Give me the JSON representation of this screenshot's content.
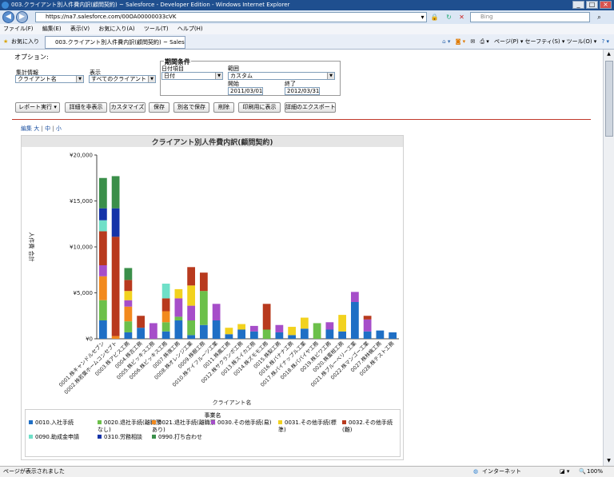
{
  "browser": {
    "title": "003.クライアント別人件費内訳(顧問契約) ~ Salesforce - Developer Edition - Windows Internet Explorer",
    "url": "https://na7.salesforce.com/00OA00000033cVK",
    "search_placeholder": "Bing",
    "menu": [
      "ファイル(F)",
      "編集(E)",
      "表示(V)",
      "お気に入り(A)",
      "ツール(T)",
      "ヘルプ(H)"
    ],
    "favorites_label": "お気に入り",
    "tab_title": "003.クライアント別人件費内訳(顧問契約) ~ Salesforc...",
    "toolbar_right": "ページ(P) ▾  セーフティ(S) ▾  ツール(O) ▾",
    "status_left": "ページが表示されました",
    "status_zone": "インターネット",
    "zoom": "100%"
  },
  "options": {
    "heading": "オプション:",
    "summarize_label": "集計情報",
    "summarize_value": "クライアント名",
    "show_label": "表示",
    "show_value": "すべてのクライアント",
    "period": {
      "heading": "期間条件",
      "date_field_label": "日付項目",
      "date_field_value": "日付",
      "range_label": "範囲",
      "range_value": "カスタム",
      "start_label": "開始",
      "start_value": "2011/03/01",
      "end_label": "終了",
      "end_value": "2012/03/31"
    }
  },
  "buttons": {
    "run": "レポート実行 ▾",
    "hide_details": "詳細を非表示",
    "customize": "カスタマイズ",
    "save": "保存",
    "save_as": "別名で保存",
    "delete": "削除",
    "printable": "印刷用に表示",
    "export": "詳細のエクスポート"
  },
  "chart_size": {
    "edit": "編集",
    "large": "大",
    "medium": "中",
    "small": "小",
    "sep": "|"
  },
  "chart_data": {
    "type": "bar",
    "stacked": true,
    "title": "クライアント別人件費内訳(顧問契約)",
    "xlabel": "クライアント名",
    "ylabel": "人件費 合計",
    "ylim": [
      0,
      20000
    ],
    "yticks": [
      "¥0",
      "¥5,000",
      "¥10,000",
      "¥15,000",
      "¥20,000"
    ],
    "grid": false,
    "legend_title": "事業名",
    "legend_position": "bottom",
    "categories": [
      "0001.株キャンドルセブン",
      "0002.株若葉ホームコンセプト",
      "0003.株アビス工務",
      "0004.株吉工務",
      "0005.株ビッキス工務",
      "0006.株ビッキス工務",
      "0007.株嶺工務",
      "0008.株オレンジ工業",
      "0009.株樹工務",
      "0010.株ケイフルーツ工業",
      "0011.株嵐工務",
      "0012.株サクランボ工務",
      "0013.株スイカ工務",
      "0014.株ズモモ工務",
      "0015.株梨工務",
      "0016.株バナナ工務",
      "0017.株パイナップル工業",
      "0018.株パパイヤ工務",
      "0019.株ビワ工務",
      "0020.株蜜柑工務",
      "0021.株ブルーベリー工業",
      "0022.株マンゴー工業",
      "0027.株林檎工務",
      "0028.株テスト工務"
    ],
    "series": [
      {
        "name": "0010.入社手続",
        "color": "#1f6fc5",
        "values": [
          2000,
          0,
          700,
          1200,
          0,
          800,
          2000,
          400,
          1500,
          2000,
          500,
          1000,
          800,
          0,
          700,
          400,
          1100,
          0,
          1000,
          800,
          4000,
          800,
          900,
          700
        ]
      },
      {
        "name": "0020.退社手続(離職票なし)",
        "color": "#6cc04a",
        "values": [
          2200,
          0,
          1200,
          0,
          0,
          1000,
          400,
          1600,
          3700,
          0,
          0,
          0,
          0,
          1000,
          0,
          0,
          0,
          1700,
          0,
          0,
          0,
          0,
          0,
          0
        ]
      },
      {
        "name": "0021.退社手続(離職票あり)",
        "color": "#f28a1e",
        "values": [
          2600,
          300,
          1600,
          0,
          0,
          1200,
          0,
          0,
          0,
          0,
          0,
          0,
          0,
          0,
          0,
          0,
          0,
          0,
          0,
          0,
          0,
          0,
          0,
          0
        ]
      },
      {
        "name": "0030.その他手続(易)",
        "color": "#a64ec9",
        "values": [
          1200,
          0,
          700,
          0,
          1700,
          0,
          2000,
          1600,
          0,
          1800,
          0,
          0,
          600,
          0,
          800,
          0,
          0,
          0,
          800,
          0,
          1100,
          1300,
          0,
          0
        ]
      },
      {
        "name": "0031.その他手続(標準)",
        "color": "#f2d21e",
        "values": [
          0,
          0,
          1000,
          0,
          0,
          0,
          1000,
          2200,
          0,
          0,
          700,
          600,
          0,
          0,
          0,
          900,
          1200,
          0,
          0,
          1800,
          0,
          0,
          0,
          0
        ]
      },
      {
        "name": "0032.その他手続(難)",
        "color": "#b83a1e",
        "values": [
          3700,
          10800,
          1200,
          1300,
          0,
          1400,
          0,
          2000,
          2000,
          0,
          0,
          0,
          0,
          2800,
          0,
          0,
          0,
          0,
          0,
          0,
          0,
          400,
          0,
          0
        ]
      },
      {
        "name": "0090.助成金申請",
        "color": "#6fe0c8",
        "values": [
          1200,
          0,
          0,
          0,
          0,
          1600,
          0,
          0,
          0,
          0,
          0,
          0,
          0,
          0,
          0,
          0,
          0,
          0,
          0,
          0,
          0,
          0,
          0,
          0
        ]
      },
      {
        "name": "0310.労務相談",
        "color": "#1433a8",
        "values": [
          1300,
          3100,
          0,
          0,
          0,
          0,
          0,
          0,
          0,
          0,
          0,
          0,
          0,
          0,
          0,
          0,
          0,
          0,
          0,
          0,
          0,
          0,
          0,
          0
        ]
      },
      {
        "name": "0990.打ち合わせ",
        "color": "#3b8f4a",
        "values": [
          3300,
          3500,
          1300,
          0,
          0,
          0,
          0,
          0,
          0,
          0,
          0,
          0,
          0,
          0,
          0,
          0,
          0,
          0,
          0,
          0,
          0,
          0,
          0,
          0
        ]
      }
    ]
  }
}
